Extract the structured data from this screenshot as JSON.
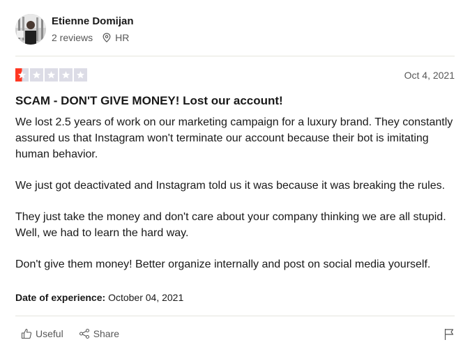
{
  "reviewer": {
    "name": "Etienne Domijan",
    "reviews": "2 reviews",
    "country": "HR"
  },
  "rating": {
    "stars": 1,
    "max": 5,
    "color": "#ff3722"
  },
  "review": {
    "date": "Oct 4, 2021",
    "title": "SCAM - DON'T GIVE MONEY! Lost our account!",
    "paragraphs": [
      "We lost 2.5 years of work on our marketing campaign for a luxury brand. They constantly assured us that Instagram won't terminate our account because their bot is imitating human behavior.",
      "We just got deactivated and Instagram told us it was because it was breaking the rules.",
      "They just take the money and don't care about your company thinking we are all stupid. Well, we had to learn the hard way.",
      "Don't give them money! Better organize internally and post on social media yourself."
    ],
    "experience_label": "Date of experience:",
    "experience_date": "October 04, 2021"
  },
  "actions": {
    "useful": "Useful",
    "share": "Share"
  },
  "icons": {
    "location": "location-pin-icon",
    "useful": "thumbs-up-icon",
    "share": "share-icon",
    "flag": "flag-icon",
    "star": "star-icon"
  }
}
